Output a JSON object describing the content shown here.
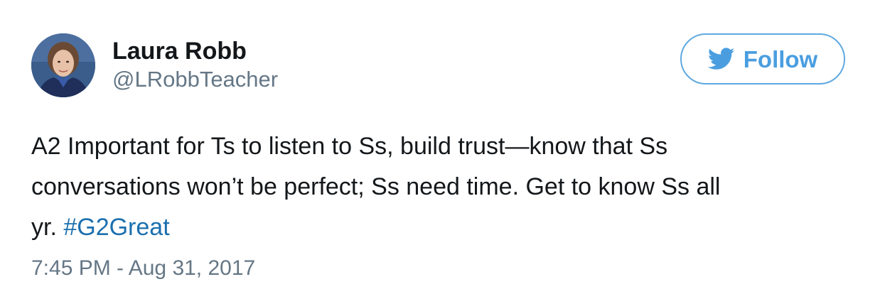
{
  "tweet": {
    "author": {
      "display_name": "Laura Robb",
      "handle": "@LRobbTeacher",
      "avatar_icon": "profile-photo"
    },
    "follow_button": {
      "label": "Follow",
      "icon": "twitter-bird-icon",
      "color": "#4a9ee0"
    },
    "text_lines": [
      "A2 Important for Ts to listen to Ss, build trust—know that Ss",
      "conversations won’t be perfect; Ss need time. Get to know Ss all",
      "yr. "
    ],
    "hashtag": "#G2Great",
    "timestamp": "7:45 PM - Aug 31, 2017"
  }
}
